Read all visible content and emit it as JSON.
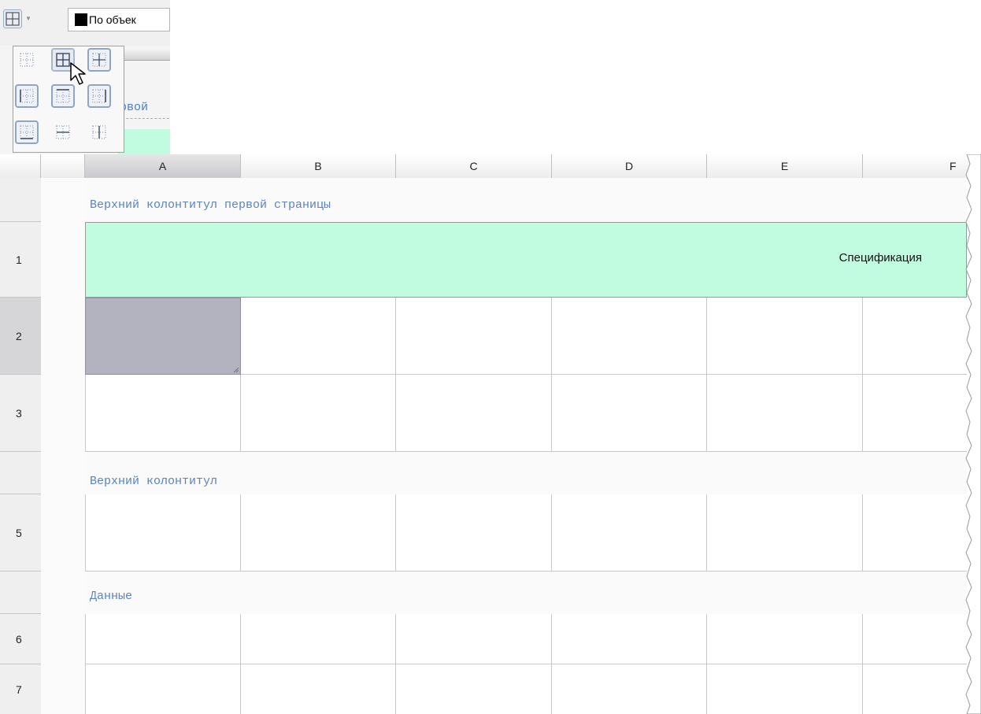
{
  "toolbar": {
    "border_button_icon": "all-borders-icon",
    "dropdown_arrow_icon": "chevron-down-icon",
    "color_select_value": "По объек",
    "color_swatch": "#000000"
  },
  "preview": {
    "fragment_text": "рвой"
  },
  "border_popup": {
    "items": [
      {
        "icon": "no-borders-icon"
      },
      {
        "icon": "all-borders-icon"
      },
      {
        "icon": "inner-borders-icon"
      },
      {
        "icon": "left-border-icon"
      },
      {
        "icon": "top-border-icon"
      },
      {
        "icon": "right-border-icon"
      },
      {
        "icon": "bottom-border-icon"
      },
      {
        "icon": "inner-horizontal-icon"
      },
      {
        "icon": "inner-vertical-icon"
      }
    ]
  },
  "sheet": {
    "columns": [
      "A",
      "B",
      "C",
      "D",
      "E",
      "F"
    ],
    "rows": [
      "1",
      "2",
      "3",
      "5",
      "6",
      "7"
    ],
    "sections": {
      "first_page_header": "Верхний колонтитул первой страницы",
      "header": "Верхний колонтитул",
      "data": "Данные"
    },
    "row1_text": "Спецификация",
    "colors": {
      "row1_fill": "#c2fce0",
      "section_label": "#5a84bf",
      "selected_cell": "#b3b3bf"
    }
  }
}
